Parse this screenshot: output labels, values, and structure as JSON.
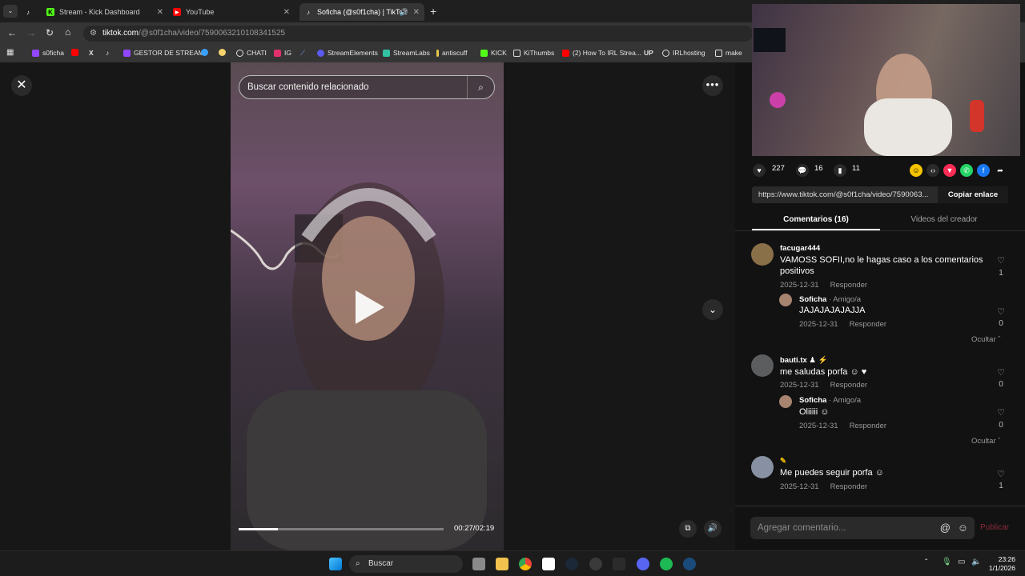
{
  "browser": {
    "tabs": [
      {
        "title": "",
        "icon": "tiktok-icon"
      },
      {
        "title": "Stream - Kick Dashboard",
        "icon": "kick-icon"
      },
      {
        "title": "YouTube",
        "icon": "youtube-icon"
      },
      {
        "title": "Soficha (@s0f1cha) | TikTok",
        "icon": "tiktok-icon"
      }
    ],
    "url_host": "tiktok.com",
    "url_path": "/@s0f1cha/video/7590063210108341525",
    "bookmarks": [
      "s0ficha",
      "",
      "",
      "",
      "GESTOR DE STREAM",
      "",
      "",
      "CHATI",
      "IG",
      "",
      "StreamElements",
      "StreamLabs",
      "antiscuff",
      "KICK",
      "KiThumbs",
      "(2) How To IRL Strea...",
      "UP",
      "IRLhosting",
      "make"
    ]
  },
  "video": {
    "search_placeholder": "Buscar contenido relacionado",
    "current_time": "00:27/02:19",
    "progress_fraction": 0.19
  },
  "actions": {
    "likes": "227",
    "comments": "16",
    "saves": "11"
  },
  "share": {
    "link": "https://www.tiktok.com/@s0f1cha/video/7590063...",
    "copy_label": "Copiar enlace"
  },
  "tabs": {
    "comments": "Comentarios (16)",
    "creator": "Videos del creador"
  },
  "comments": [
    {
      "user": "facugar444",
      "text": "VAMOSS SOFII,no le hagas caso a los comentarios positivos",
      "date": "2025-12-31",
      "reply": "Responder",
      "likes": "1"
    },
    {
      "user": "Soficha",
      "tag": " · Amigo/a",
      "text": "JAJAJAJAJAJJA",
      "date": "2025-12-31",
      "reply": "Responder",
      "likes": "0"
    },
    {
      "user": "bauti.tx",
      "text": "me saludas porfa",
      "date": "2025-12-31",
      "reply": "Responder",
      "likes": "0"
    },
    {
      "user": "Soficha",
      "tag": " · Amigo/a",
      "text": "Oliiiii",
      "date": "2025-12-31",
      "reply": "Responder",
      "likes": "0"
    },
    {
      "user": "",
      "text": "Me puedes seguir porfa",
      "date": "2025-12-31",
      "reply": "Responder",
      "likes": "1"
    }
  ],
  "hide_label": "Ocultar",
  "composer": {
    "placeholder": "Agregar comentario...",
    "publish": "Publicar"
  },
  "taskbar": {
    "search": "Buscar",
    "time": "23:26",
    "date": "1/1/2026"
  },
  "colors": {
    "accent": "#fe2c55",
    "kick": "#53fc18",
    "youtube": "#ff0000"
  }
}
